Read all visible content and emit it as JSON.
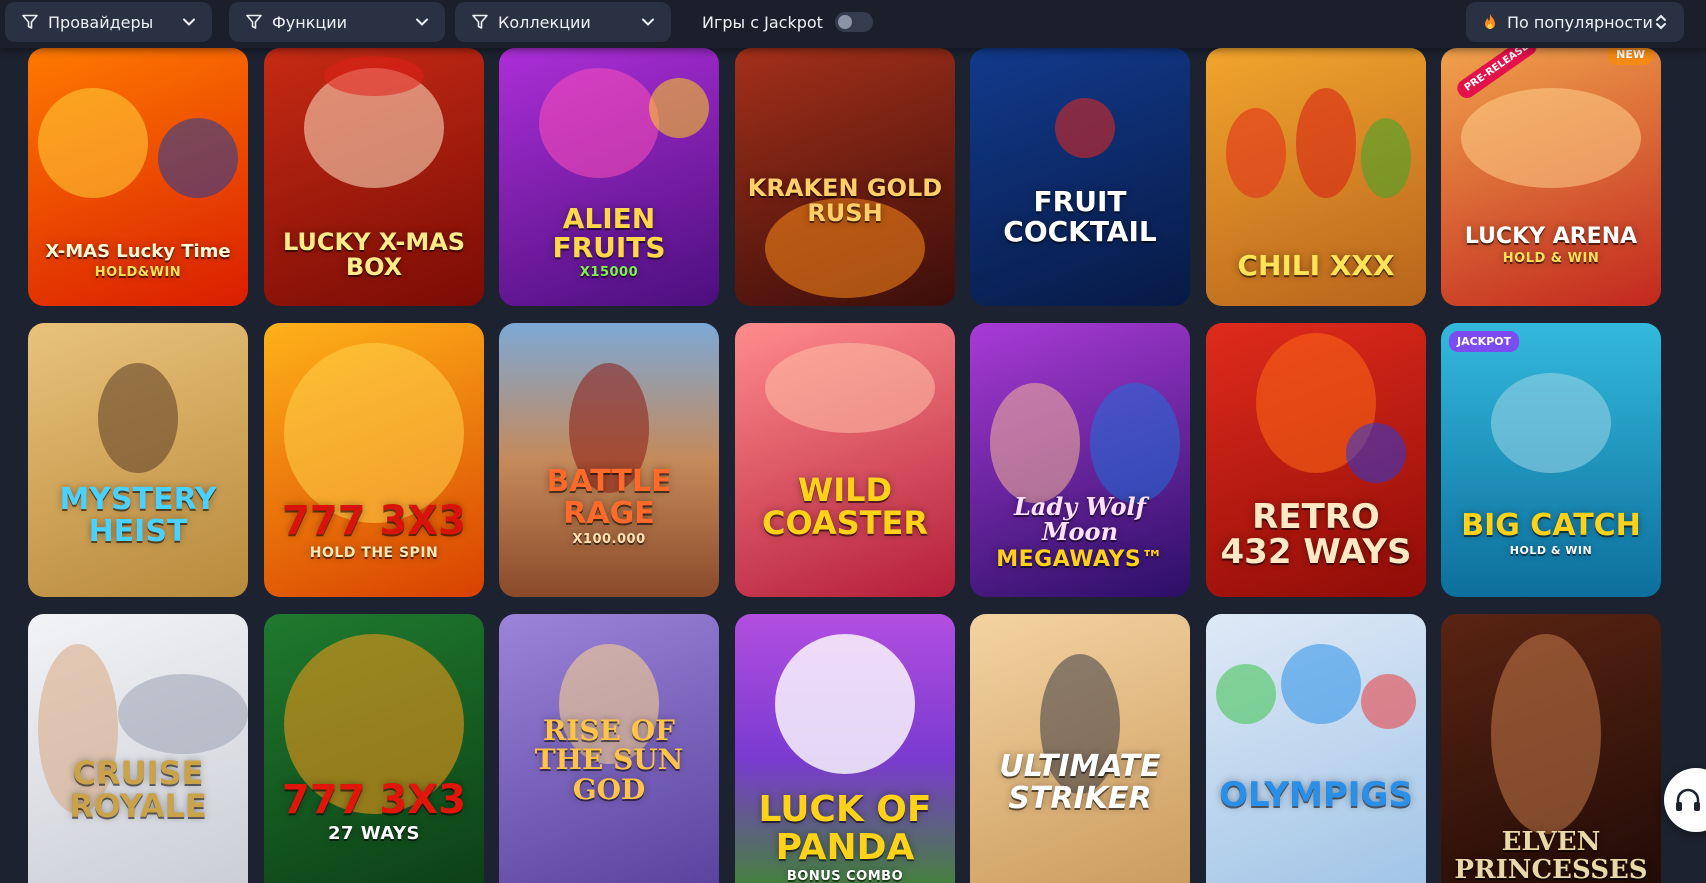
{
  "filters": {
    "providers_label": "Провайдеры",
    "features_label": "Функции",
    "collections_label": "Коллекции",
    "jackpot_label": "Игры с Jackpot",
    "jackpot_enabled": false,
    "sort_label": "По популярности"
  },
  "games": [
    {
      "title": "X-MAS Lucky Time",
      "sub": "HOLD&WIN",
      "badge": "",
      "colors": [
        "#ff7a00",
        "#d91e00"
      ]
    },
    {
      "title": "LUCKY X-MAS BOX",
      "sub": "",
      "badge": "",
      "colors": [
        "#c62b14",
        "#7a0c05"
      ]
    },
    {
      "title": "ALIEN FRUITS",
      "sub": "X15000",
      "badge": "",
      "colors": [
        "#ad2fd8",
        "#4b0f7d"
      ]
    },
    {
      "title": "KRAKEN GOLD RUSH",
      "sub": "",
      "badge": "",
      "colors": [
        "#a4301a",
        "#3b0e0a"
      ]
    },
    {
      "title": "FRUIT COCKTAIL",
      "sub": "",
      "badge": "",
      "colors": [
        "#123a8c",
        "#071a45"
      ]
    },
    {
      "title": "CHILI XXX",
      "sub": "",
      "badge": "",
      "colors": [
        "#f2a52d",
        "#b8641c"
      ]
    },
    {
      "title": "LUCKY ARENA",
      "sub": "HOLD & WIN",
      "badge": "NEW",
      "ribbon": "PRE-RELEASE",
      "colors": [
        "#f0a24c",
        "#c2281e"
      ]
    },
    {
      "title": "MYSTERY HEIST",
      "sub": "",
      "badge": "",
      "colors": [
        "#e9c27a",
        "#b88a3d"
      ]
    },
    {
      "title": "777 3X3",
      "sub": "HOLD THE SPIN",
      "badge": "",
      "colors": [
        "#ffb21a",
        "#d84200"
      ]
    },
    {
      "title": "BATTLE RAGE",
      "sub": "X100.000",
      "badge": "",
      "colors": [
        "#7ca8d6",
        "#8a4a2a"
      ]
    },
    {
      "title": "WILD COASTER",
      "sub": "",
      "badge": "",
      "colors": [
        "#ff8c8c",
        "#b41e3a"
      ]
    },
    {
      "title": "Lady Wolf Moon",
      "sub": "MEGAWAYS™",
      "badge": "",
      "colors": [
        "#a93bd6",
        "#2b0f66"
      ]
    },
    {
      "title": "RETRO 432 WAYS",
      "sub": "",
      "badge": "",
      "colors": [
        "#e02b1c",
        "#8f0c07"
      ]
    },
    {
      "title": "BIG CATCH",
      "sub": "HOLD & WIN",
      "badge": "JACKPOT",
      "colors": [
        "#33b9dc",
        "#0d6f9c"
      ]
    },
    {
      "title": "CRUISE ROYALE",
      "sub": "",
      "badge": "",
      "colors": [
        "#f2f3f6",
        "#c9ccd4"
      ]
    },
    {
      "title": "777 3X3",
      "sub": "27 WAYS",
      "badge": "",
      "colors": [
        "#1f7a2e",
        "#0c3d15"
      ]
    },
    {
      "title": "RISE OF THE SUN GOD",
      "sub": "",
      "badge": "",
      "colors": [
        "#9b84d9",
        "#56409a"
      ]
    },
    {
      "title": "LUCK OF PANDA",
      "sub": "BONUS COMBO",
      "badge": "",
      "colors": [
        "#b24fe0",
        "#3d8c27"
      ]
    },
    {
      "title": "ULTIMATE STRIKER",
      "sub": "",
      "badge": "",
      "colors": [
        "#f4d3a1",
        "#c9995b"
      ]
    },
    {
      "title": "OLYMPIGS",
      "sub": "",
      "badge": "",
      "colors": [
        "#dfe9f6",
        "#9ec3e6"
      ]
    },
    {
      "title": "ELVEN PRINCESSES",
      "sub": "",
      "badge": "",
      "colors": [
        "#5a2412",
        "#1e0a06"
      ]
    }
  ]
}
